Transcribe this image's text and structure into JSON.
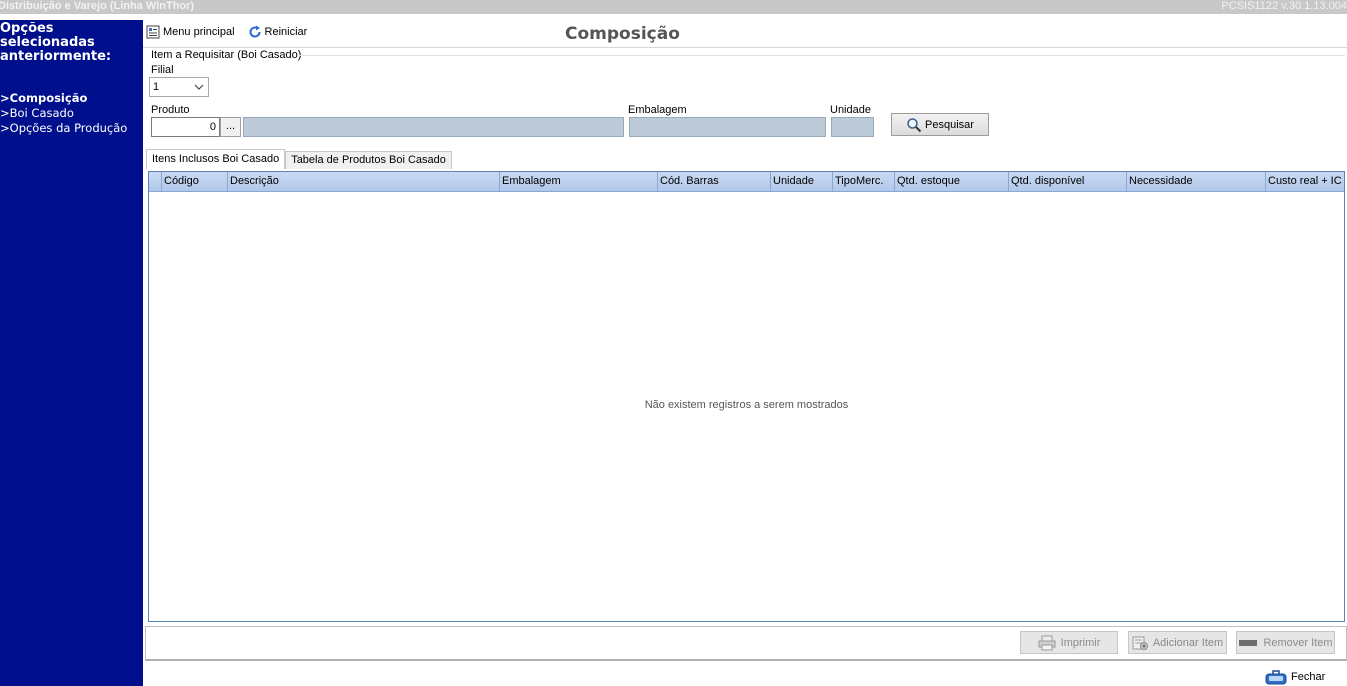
{
  "window": {
    "title": "Distribuição e Varejo (Linha WinThor)",
    "version": "PCSIS1122  v.30.1.13.004"
  },
  "sidebar": {
    "heading": "Opções selecionadas\nanteriormente:",
    "items": [
      {
        "label": ">Composição",
        "active": true
      },
      {
        "label": ">Boi Casado",
        "active": false
      },
      {
        "label": ">Opções da Produção",
        "active": false
      }
    ]
  },
  "toolbar": {
    "menu_label": "Menu principal",
    "restart_label": "Reiniciar"
  },
  "page_title": "Composição",
  "form": {
    "group_label": "Item a Requisitar (Boi Casado)",
    "filial_label": "Filial",
    "filial_value": "1",
    "produto_label": "Produto",
    "produto_code": "0",
    "produto_button": "...",
    "produto_desc": "",
    "embalagem_label": "Embalagem",
    "embalagem_value": "",
    "unidade_label": "Unidade",
    "unidade_value": "",
    "search_label": "Pesquisar"
  },
  "tabs": [
    {
      "label": "Itens Inclusos Boi Casado",
      "active": true
    },
    {
      "label": "Tabela de Produtos Boi Casado",
      "active": false
    }
  ],
  "grid": {
    "columns": [
      "Código",
      "Descrição",
      "Embalagem",
      "Cód. Barras",
      "Unidade",
      "TipoMerc.",
      "Qtd. estoque",
      "Qtd. disponível",
      "Necessidade",
      "Custo real + IC"
    ],
    "empty_message": "Não existem registros a serem mostrados"
  },
  "actions": {
    "print_label": "Imprimir",
    "add_label": "Adicionar Item",
    "remove_label": "Remover Item",
    "close_label": "Fechar"
  },
  "colors": {
    "sidebar_bg": "#000f8c",
    "grid_header": "#c9daf2",
    "readonly_field": "#bdcad8"
  }
}
